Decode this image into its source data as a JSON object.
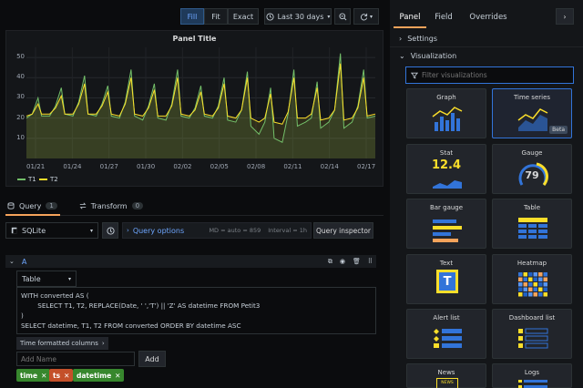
{
  "toolbar": {
    "fill_label": "Fill",
    "fit_label": "Fit",
    "exact_label": "Exact",
    "time_range": "Last 30 days"
  },
  "panel": {
    "title": "Panel Title",
    "legend": [
      {
        "name": "T1",
        "color": "#73bf69"
      },
      {
        "name": "T2",
        "color": "#fade2a"
      }
    ]
  },
  "chart_data": {
    "type": "line",
    "title": "Panel Title",
    "x_ticks": [
      "01/21",
      "01/24",
      "01/27",
      "01/30",
      "02/02",
      "02/05",
      "02/08",
      "02/11",
      "02/14",
      "02/17"
    ],
    "y_ticks": [
      10,
      20,
      30,
      40,
      50
    ],
    "ylim": [
      0,
      55
    ],
    "xlim": [
      0,
      30
    ],
    "grid": true,
    "legend": "bottom-left",
    "series": [
      {
        "name": "T1",
        "color": "#73bf69",
        "points": [
          [
            0,
            20
          ],
          [
            0.5,
            22
          ],
          [
            1,
            30
          ],
          [
            1.3,
            21
          ],
          [
            2,
            21
          ],
          [
            2.5,
            26
          ],
          [
            3,
            35
          ],
          [
            3.3,
            22
          ],
          [
            4,
            21
          ],
          [
            4.5,
            28
          ],
          [
            5,
            41
          ],
          [
            5.3,
            22
          ],
          [
            6,
            21
          ],
          [
            6.5,
            27
          ],
          [
            7,
            36
          ],
          [
            7.3,
            21
          ],
          [
            8,
            20
          ],
          [
            8.5,
            28
          ],
          [
            9,
            44
          ],
          [
            9.3,
            21
          ],
          [
            10,
            19
          ],
          [
            10.5,
            26
          ],
          [
            11,
            37
          ],
          [
            11.3,
            20
          ],
          [
            12,
            19
          ],
          [
            12.5,
            27
          ],
          [
            13,
            44
          ],
          [
            13.3,
            21
          ],
          [
            14,
            20
          ],
          [
            14.5,
            25
          ],
          [
            15,
            36
          ],
          [
            15.3,
            21
          ],
          [
            16,
            20
          ],
          [
            16.5,
            26
          ],
          [
            17,
            40
          ],
          [
            17.3,
            19
          ],
          [
            18,
            18
          ],
          [
            18.5,
            24
          ],
          [
            19,
            43
          ],
          [
            19.3,
            16
          ],
          [
            20,
            12
          ],
          [
            20.5,
            18
          ],
          [
            21,
            35
          ],
          [
            21.3,
            10
          ],
          [
            22,
            8
          ],
          [
            22.5,
            22
          ],
          [
            23,
            44
          ],
          [
            23.3,
            16
          ],
          [
            24,
            18
          ],
          [
            24.5,
            20
          ],
          [
            25,
            38
          ],
          [
            25.3,
            15
          ],
          [
            26,
            18
          ],
          [
            26.5,
            24
          ],
          [
            27,
            52
          ],
          [
            27.3,
            15
          ],
          [
            28,
            18
          ],
          [
            28.5,
            26
          ],
          [
            29,
            44
          ],
          [
            29.3,
            20
          ],
          [
            30,
            21
          ]
        ]
      },
      {
        "name": "T2",
        "color": "#fade2a",
        "points": [
          [
            0,
            21
          ],
          [
            0.5,
            22
          ],
          [
            1,
            27
          ],
          [
            1.3,
            22
          ],
          [
            2,
            22
          ],
          [
            2.5,
            25
          ],
          [
            3,
            31
          ],
          [
            3.3,
            22
          ],
          [
            4,
            22
          ],
          [
            4.5,
            27
          ],
          [
            5,
            37
          ],
          [
            5.3,
            22
          ],
          [
            6,
            22
          ],
          [
            6.5,
            26
          ],
          [
            7,
            33
          ],
          [
            7.3,
            22
          ],
          [
            8,
            21
          ],
          [
            8.5,
            27
          ],
          [
            9,
            40
          ],
          [
            9.3,
            22
          ],
          [
            10,
            21
          ],
          [
            10.5,
            25
          ],
          [
            11,
            34
          ],
          [
            11.3,
            21
          ],
          [
            12,
            21
          ],
          [
            12.5,
            26
          ],
          [
            13,
            40
          ],
          [
            13.3,
            22
          ],
          [
            14,
            21
          ],
          [
            14.5,
            24
          ],
          [
            15,
            33
          ],
          [
            15.3,
            22
          ],
          [
            16,
            21
          ],
          [
            16.5,
            25
          ],
          [
            17,
            37
          ],
          [
            17.3,
            21
          ],
          [
            18,
            20
          ],
          [
            18.5,
            24
          ],
          [
            19,
            40
          ],
          [
            19.3,
            20
          ],
          [
            20,
            18
          ],
          [
            20.5,
            20
          ],
          [
            21,
            32
          ],
          [
            21.3,
            18
          ],
          [
            22,
            17
          ],
          [
            22.5,
            23
          ],
          [
            23,
            40
          ],
          [
            23.3,
            20
          ],
          [
            24,
            20
          ],
          [
            24.5,
            22
          ],
          [
            25,
            35
          ],
          [
            25.3,
            19
          ],
          [
            26,
            20
          ],
          [
            26.5,
            24
          ],
          [
            27,
            47
          ],
          [
            27.3,
            19
          ],
          [
            28,
            20
          ],
          [
            28.5,
            25
          ],
          [
            29,
            40
          ],
          [
            29.3,
            21
          ],
          [
            30,
            22
          ]
        ]
      }
    ]
  },
  "query_tabs": [
    {
      "label": "Query",
      "count": "1"
    },
    {
      "label": "Transform",
      "count": "0"
    }
  ],
  "query": {
    "datasource": "SQLite",
    "query_options_label": "Query options",
    "md_info": "MD = auto = 859",
    "interval_info": "Interval = 1h",
    "inspector_label": "Query inspector",
    "ref_id": "A",
    "format": "Table",
    "sql": "WITH converted AS (\n        SELECT T1, T2, REPLACE(Date, ' ','T') || 'Z' AS datetime FROM Petit3\n)\nSELECT datetime, T1, T2 FROM converted ORDER BY datetime ASC",
    "time_formatted_label": "Time formatted columns",
    "add_placeholder": "Add Name",
    "add_label": "Add",
    "tags": [
      {
        "label": "time",
        "color": "#37872d"
      },
      {
        "label": "ts",
        "color": "#c4502a"
      },
      {
        "label": "datetime",
        "color": "#37872d"
      }
    ]
  },
  "right_panel": {
    "tabs": [
      "Panel",
      "Field",
      "Overrides"
    ],
    "settings_label": "Settings",
    "visualization_label": "Visualization",
    "filter_placeholder": "Filter visualizations",
    "beta_label": "Beta",
    "viz": [
      {
        "name": "Graph"
      },
      {
        "name": "Time series"
      },
      {
        "name": "Stat",
        "value": "12.4"
      },
      {
        "name": "Gauge",
        "value": "79"
      },
      {
        "name": "Bar gauge"
      },
      {
        "name": "Table"
      },
      {
        "name": "Text",
        "letter": "T"
      },
      {
        "name": "Heatmap"
      },
      {
        "name": "Alert list"
      },
      {
        "name": "Dashboard list"
      },
      {
        "name": "News",
        "badge": "NEWS"
      },
      {
        "name": "Logs"
      }
    ]
  }
}
